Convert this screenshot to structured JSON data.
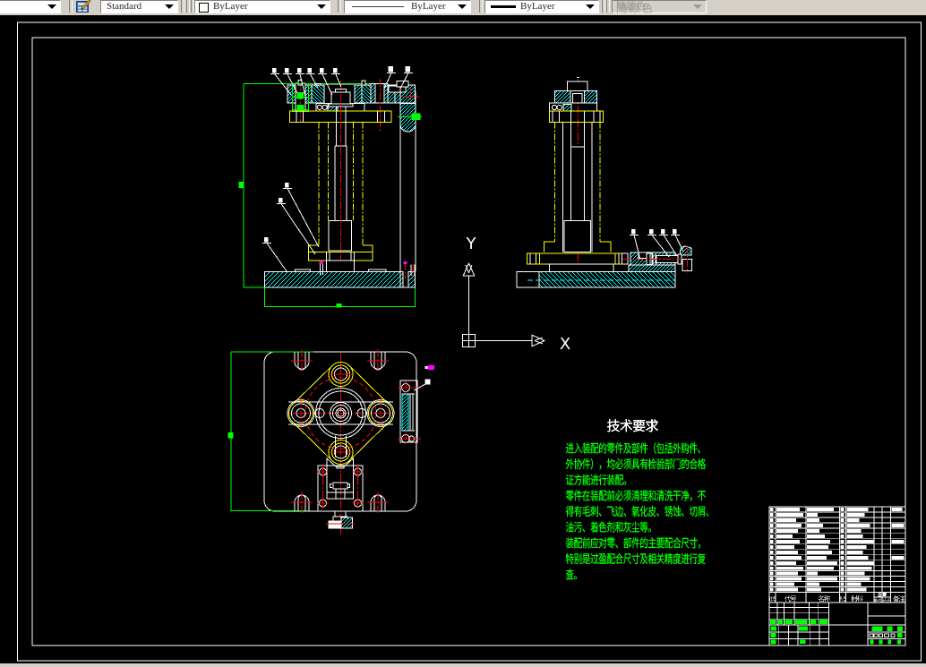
{
  "toolbar": {
    "background": "#d4d0c8",
    "text_style_combo": {
      "value": "Standard"
    },
    "color_combo": {
      "value": "ByLayer",
      "swatch": "#ffffff"
    },
    "linetype_combo": {
      "value": "ByLayer"
    },
    "lineweight_combo": {
      "value": "ByLayer"
    },
    "plot_style_combo": {
      "value": "随颜色",
      "disabled": true
    }
  },
  "ucs_icon": {
    "x_label": "X",
    "y_label": "Y"
  },
  "tech_requirements": {
    "title": "技术要求",
    "lines": [
      "进入装配的零件及部件（包括外购件、",
      "外协件），均必须具有检验部门的合格",
      "证方能进行装配。",
      "零件在装配前必须清理和清洗干净，不",
      "得有毛刺、飞边、氧化皮、锈蚀、切屑、",
      "油污、着色剂和灰尘等。",
      "装配前应对零、部件的主要配合尺寸，",
      "特别是过盈配合尺寸及相关精度进行复",
      "查。"
    ],
    "text_color": "#00ff00",
    "title_color": "#ffffff"
  },
  "parts_list": {
    "header": [
      "序号",
      "代号",
      "名称",
      "数量",
      "材料",
      "重量",
      "单件",
      "总计",
      "备注"
    ],
    "row_bars": [
      [
        26,
        30,
        4,
        24,
        0,
        0,
        12
      ],
      [
        30,
        12,
        4,
        20,
        0,
        0,
        0
      ],
      [
        22,
        14,
        4,
        14,
        0,
        0,
        0
      ],
      [
        28,
        18,
        4,
        26,
        0,
        0,
        14
      ],
      [
        24,
        14,
        4,
        16,
        0,
        0,
        0
      ],
      [
        18,
        20,
        4,
        18,
        0,
        0,
        0
      ],
      [
        26,
        26,
        4,
        30,
        0,
        0,
        14
      ],
      [
        20,
        24,
        4,
        22,
        0,
        0,
        0
      ],
      [
        24,
        28,
        4,
        18,
        0,
        0,
        0
      ],
      [
        28,
        22,
        4,
        24,
        0,
        0,
        14
      ],
      [
        22,
        34,
        4,
        30,
        0,
        0,
        0
      ],
      [
        30,
        30,
        4,
        28,
        0,
        0,
        0
      ],
      [
        24,
        12,
        4,
        20,
        0,
        0,
        0
      ],
      [
        28,
        34,
        4,
        26,
        0,
        0,
        0
      ],
      [
        20,
        14,
        4,
        16,
        0,
        0,
        0
      ],
      [
        24,
        16,
        4,
        22,
        0,
        0,
        0
      ]
    ]
  },
  "title_block": {
    "signature_marks": [
      [
        860,
        692.2,
        6.5,
        4.6
      ],
      [
        869,
        692.2,
        5,
        4.6
      ],
      [
        876.5,
        692.2,
        8.5,
        4.6
      ],
      [
        888,
        692.2,
        13.5,
        4.6
      ],
      [
        904.5,
        692.2,
        7,
        4.6
      ],
      [
        914.5,
        692.2,
        10,
        4.6
      ],
      [
        860.7,
        699.3,
        6.5,
        5
      ],
      [
        892,
        699.3,
        10,
        5
      ],
      [
        860.7,
        707.2,
        6,
        4.8
      ],
      [
        860.7,
        714.5,
        6,
        5
      ],
      [
        893,
        714.5,
        6.5,
        4.6
      ],
      [
        973.3,
        699.5,
        12.4,
        5.4
      ],
      [
        990.6,
        699.5,
        6,
        5.4
      ],
      [
        1002.1,
        699.5,
        6,
        5.4
      ],
      [
        1002.1,
        707.2,
        5.5,
        4.8
      ],
      [
        971.7,
        714.6,
        3.8,
        5
      ],
      [
        981.6,
        714.6,
        3.8,
        5
      ],
      [
        991.4,
        714.6,
        3.8,
        5
      ],
      [
        1002.1,
        714.6,
        3.8,
        5
      ]
    ],
    "stamp_boxes": [
      [
        970.9,
        707.8,
        4,
        3.8
      ],
      [
        975.8,
        707.8,
        4,
        3.8
      ],
      [
        981.6,
        707.8,
        4,
        3.8
      ],
      [
        987.4,
        707.8,
        5,
        3.8
      ],
      [
        994.8,
        707.8,
        4,
        3.8
      ]
    ]
  },
  "drawing_colors": {
    "canvas_background": "#000000",
    "outline": "#ffffff",
    "hatch": "#00ffff",
    "part": "#ffff00",
    "centerline": "#ff0000",
    "dimension": "#00ff00",
    "highlight": "#ff00ff"
  }
}
